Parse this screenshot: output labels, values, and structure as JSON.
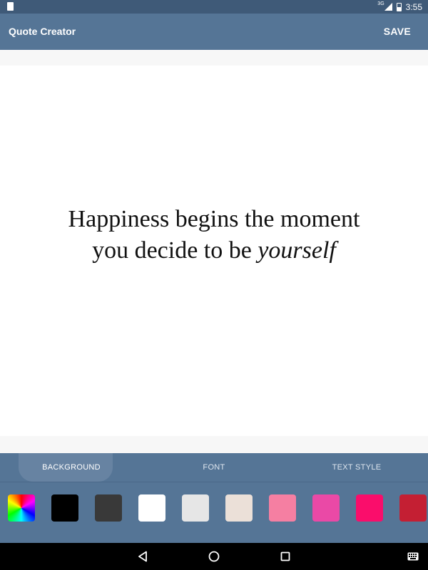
{
  "status_bar": {
    "network": "3G",
    "time": "3:55"
  },
  "app_bar": {
    "title": "Quote Creator",
    "save_label": "SAVE"
  },
  "quote": {
    "line1": "Happiness begins the moment",
    "line2_plain": "you decide to be ",
    "line2_emphasis": "yourself",
    "background_color": "#ffffff",
    "text_color": "#111111"
  },
  "tabs": [
    {
      "label": "BACKGROUND",
      "active": true
    },
    {
      "label": "FONT",
      "active": false
    },
    {
      "label": "TEXT STYLE",
      "active": false
    }
  ],
  "swatches": [
    {
      "name": "spectrum-picker",
      "color": "spectrum"
    },
    {
      "name": "black",
      "color": "#000000"
    },
    {
      "name": "dark-gray",
      "color": "#393939"
    },
    {
      "name": "white",
      "color": "#ffffff"
    },
    {
      "name": "light-gray",
      "color": "#e6e6e6"
    },
    {
      "name": "beige",
      "color": "#ebe0d8"
    },
    {
      "name": "light-pink",
      "color": "#f57fa2"
    },
    {
      "name": "magenta-pink",
      "color": "#ea49a6"
    },
    {
      "name": "hot-pink",
      "color": "#fa0d6b"
    },
    {
      "name": "crimson",
      "color": "#c41f33"
    }
  ],
  "colors": {
    "status_bar": "#3f5a78",
    "app_bar": "#557596",
    "active_tab": "#6783a2"
  },
  "icons": {
    "nav_back": "back-triangle",
    "nav_home": "home-circle",
    "nav_recent": "recent-square",
    "nav_keyboard": "keyboard"
  }
}
